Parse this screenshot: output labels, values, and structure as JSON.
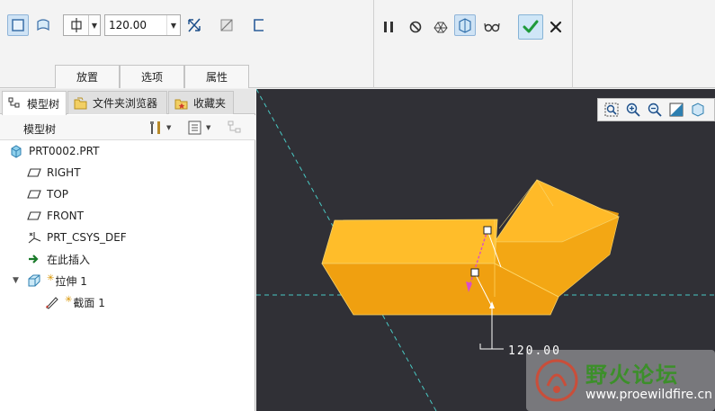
{
  "ribbon": {
    "depth_value": "120.00",
    "tabs": [
      {
        "label": "放置"
      },
      {
        "label": "选项"
      },
      {
        "label": "属性"
      }
    ]
  },
  "panel": {
    "tabs": [
      {
        "label": "模型树",
        "icon": "model-tree-icon"
      },
      {
        "label": "文件夹浏览器",
        "icon": "folder-browser-icon"
      },
      {
        "label": "收藏夹",
        "icon": "favorites-icon"
      }
    ],
    "tree_title": "模型树"
  },
  "tree": {
    "items": [
      {
        "label": "PRT0002.PRT",
        "icon": "part-icon"
      },
      {
        "label": "RIGHT",
        "icon": "datum-plane-icon"
      },
      {
        "label": "TOP",
        "icon": "datum-plane-icon"
      },
      {
        "label": "FRONT",
        "icon": "datum-plane-icon"
      },
      {
        "label": "PRT_CSYS_DEF",
        "icon": "coordinate-system-icon"
      },
      {
        "label": "在此插入",
        "icon": "insert-here-arrow-icon"
      },
      {
        "label": "拉伸 1",
        "icon": "extrude-icon"
      },
      {
        "label": "截面 1",
        "icon": "sketch-icon"
      }
    ]
  },
  "viewport": {
    "dimension_label": "120.00",
    "watermark_title": "野火论坛",
    "watermark_url": "www.proewildfire.cn"
  },
  "colors": {
    "viewport_bg": "#303036",
    "solid_face_top": "#ffbd2a",
    "solid_face_front": "#f0a010",
    "ok_green": "#1f9a3a"
  }
}
